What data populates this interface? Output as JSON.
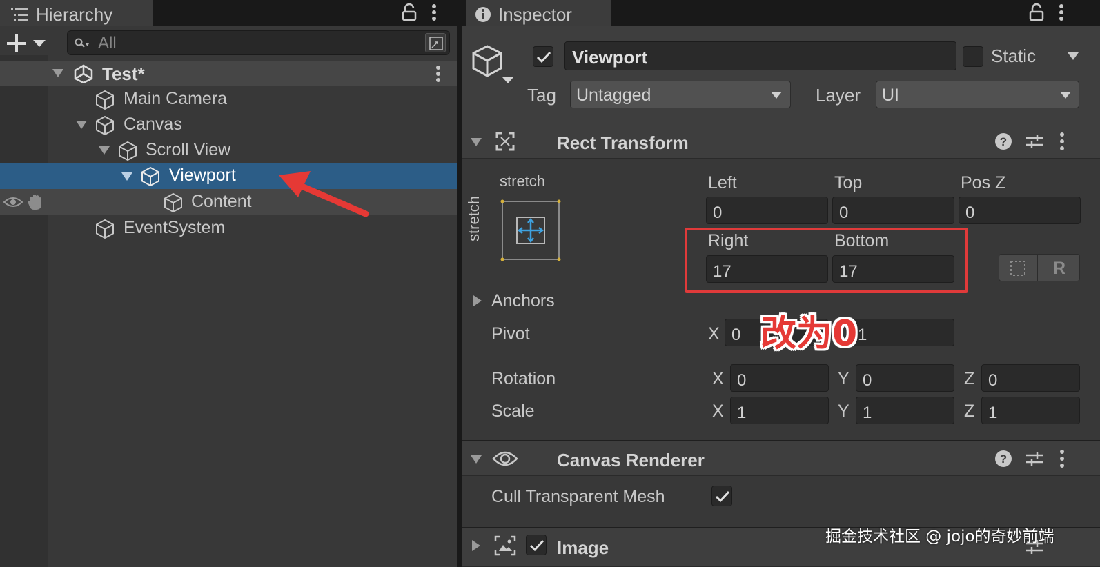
{
  "hierarchy": {
    "tab_label": "Hierarchy",
    "search_placeholder": "All",
    "scene": "Test*",
    "items": [
      {
        "label": "Main Camera"
      },
      {
        "label": "Canvas"
      },
      {
        "label": "Scroll View"
      },
      {
        "label": "Viewport"
      },
      {
        "label": "Content"
      },
      {
        "label": "EventSystem"
      }
    ]
  },
  "inspector": {
    "tab_label": "Inspector",
    "object_name": "Viewport",
    "active": true,
    "static_label": "Static",
    "tag_label": "Tag",
    "tag_value": "Untagged",
    "layer_label": "Layer",
    "layer_value": "UI",
    "rect_transform": {
      "title": "Rect Transform",
      "anchor_h": "stretch",
      "anchor_v": "stretch",
      "left_label": "Left",
      "left_value": "0",
      "top_label": "Top",
      "top_value": "0",
      "posz_label": "Pos Z",
      "posz_value": "0",
      "right_label": "Right",
      "right_value": "17",
      "bottom_label": "Bottom",
      "bottom_value": "17",
      "anchors_label": "Anchors",
      "pivot_label": "Pivot",
      "pivot_x": "0",
      "pivot_y": "1",
      "rotation_label": "Rotation",
      "rot_x": "0",
      "rot_y": "0",
      "rot_z": "0",
      "scale_label": "Scale",
      "scale_x": "1",
      "scale_y": "1",
      "scale_z": "1",
      "axis_x": "X",
      "axis_y": "Y",
      "axis_z": "Z",
      "r_button": "R"
    },
    "canvas_renderer": {
      "title": "Canvas Renderer",
      "cull_label": "Cull Transparent Mesh",
      "cull_checked": true
    },
    "image": {
      "title": "Image",
      "enabled": true
    }
  },
  "annotation": {
    "text": "改为0",
    "color": "#e53935"
  },
  "watermark": "掘金技术社区 @ jojo的奇妙前端"
}
